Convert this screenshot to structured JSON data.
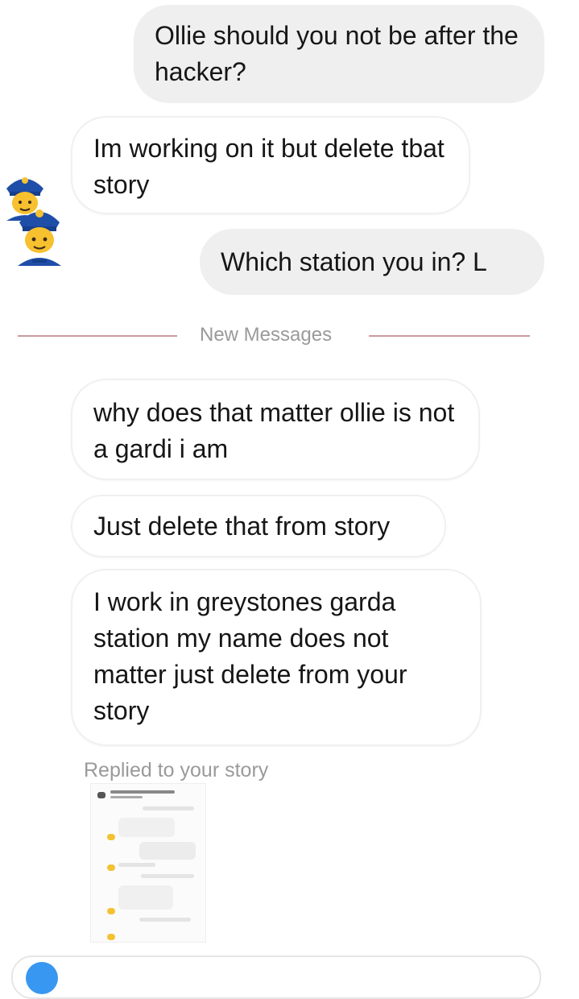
{
  "messages": [
    {
      "side": "outgoing",
      "text": "Ollie should you not be after the hacker?"
    },
    {
      "side": "incoming",
      "text": "Im working on it but delete tbat story"
    },
    {
      "side": "outgoing",
      "text": "Which station you in? L"
    },
    {
      "side": "incoming",
      "text": "why does that matter ollie is not a gardi i am"
    },
    {
      "side": "incoming",
      "text": "Just delete that from story"
    },
    {
      "side": "incoming",
      "text": "I work in greystones garda station  my name does not matter just delete from your story"
    }
  ],
  "divider": {
    "label": "New Messages"
  },
  "story_reply": {
    "label": "Replied to your story"
  },
  "avatars": [
    {
      "icon": "police-officer-emoji"
    },
    {
      "icon": "police-officer-emoji"
    }
  ]
}
